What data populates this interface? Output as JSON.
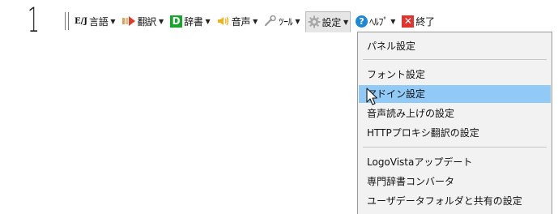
{
  "step_number": "1",
  "toolbar": {
    "items": [
      {
        "label": "言語",
        "icon": "ej-language-icon",
        "icon_text": "E/J",
        "has_caret": true
      },
      {
        "label": "翻訳",
        "icon": "translate-arrow-icon",
        "has_caret": true
      },
      {
        "label": "辞書",
        "icon": "dictionary-icon",
        "icon_text": "D",
        "has_caret": true
      },
      {
        "label": "音声",
        "icon": "speaker-icon",
        "has_caret": true
      },
      {
        "label": "ﾂｰﾙ",
        "icon": "tool-icon",
        "has_caret": true
      },
      {
        "label": "設定",
        "icon": "gear-icon",
        "has_caret": true,
        "active": true
      },
      {
        "label": "ﾍﾙﾌﾟ",
        "icon": "help-icon",
        "icon_text": "?",
        "has_caret": true
      },
      {
        "label": "終了",
        "icon": "exit-icon",
        "icon_text": "✕",
        "has_caret": false
      }
    ],
    "caret_glyph": "▼"
  },
  "settings_menu": {
    "groups": [
      [
        "パネル設定"
      ],
      [
        "フォント設定",
        "アドイン設定",
        "音声読み上げの設定",
        "HTTPプロキシ翻訳の設定"
      ],
      [
        "LogoVistaアップデート",
        "専門辞書コンバータ",
        "ユーザデータフォルダと共有の設定"
      ]
    ],
    "highlighted_item": "アドイン設定"
  },
  "colors": {
    "menu_background": "#f2f2f2",
    "highlight": "#91c9f7",
    "dictionary_icon": "#17a52b",
    "help_icon": "#1e88d8",
    "exit_icon": "#e2342e",
    "gear_icon": "#a8a8a8"
  }
}
